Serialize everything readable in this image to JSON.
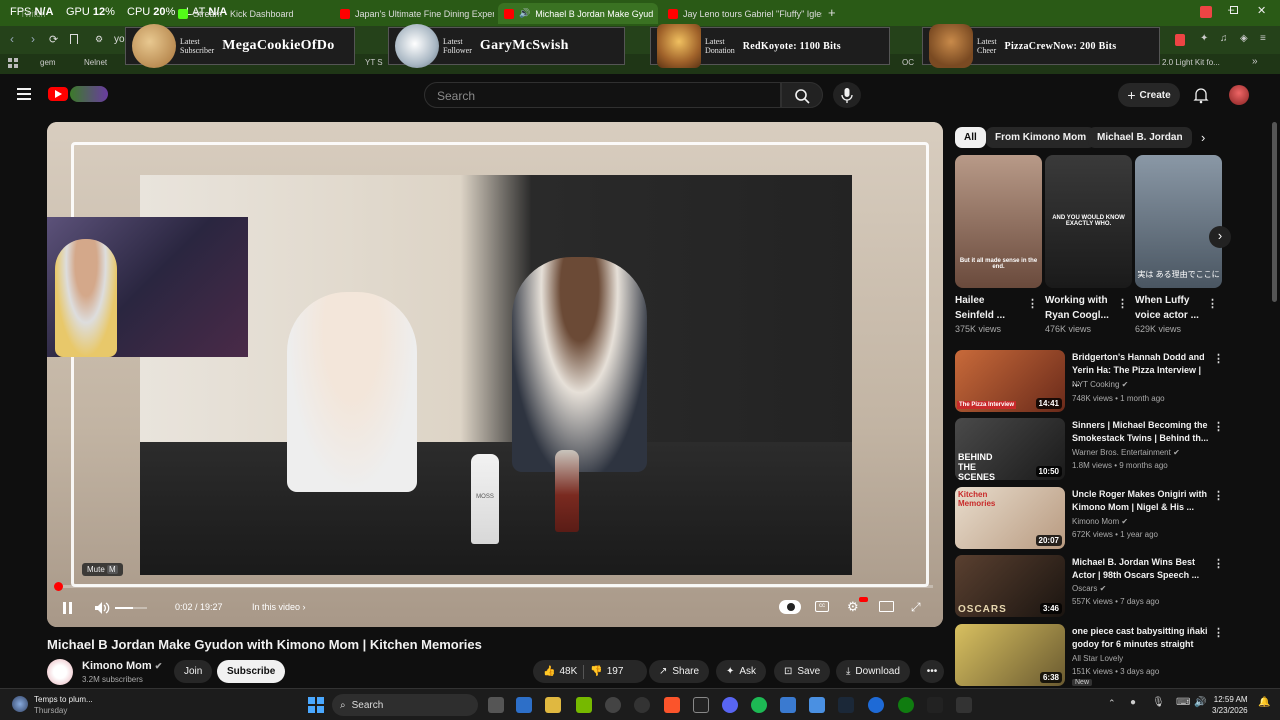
{
  "overlay": {
    "fps_label": "FPS",
    "fps_value": "N/A",
    "gpu_label": "GPU",
    "gpu_value": "12",
    "cpu_label": "CPU",
    "cpu_value": "20",
    "lat_label": "LAT",
    "lat_value": "N/A",
    "percent": "%"
  },
  "tabs": [
    {
      "label": "Twitch"
    },
    {
      "label": "Stream - Kick Dashboard"
    },
    {
      "label": "Japan's Ultimate Fine Dining Experie"
    },
    {
      "label": "Michael B Jordan Make Gyud"
    },
    {
      "label": "Jay Leno tours Gabriel \"Fluffy\" Iglesia"
    }
  ],
  "addressbar": {
    "url": "you"
  },
  "bookmarks": [
    "gem",
    "Nelnet",
    "YT S",
    "OC",
    "2.0 Light Kit fo..."
  ],
  "alerts": [
    {
      "kind1": "Latest",
      "kind2": "Subscriber",
      "name": "MegaCookieOfDo"
    },
    {
      "kind1": "Latest",
      "kind2": "Follower",
      "name": "GaryMcSwish"
    },
    {
      "kind1": "Latest",
      "kind2": "Donation",
      "name": "RedKoyote: 1100 Bits"
    },
    {
      "kind1": "Latest",
      "kind2": "Cheer",
      "name": "PizzaCrewNow: 200 Bits"
    }
  ],
  "header": {
    "search_placeholder": "Search",
    "create_label": "Create"
  },
  "player": {
    "time": "0:02 / 19:27",
    "chapter": "In this video",
    "tooltip": "Mute",
    "tooltip_key": "M",
    "progress": 0.0017,
    "volume": 0.55,
    "bottle_label": "MOSS"
  },
  "video": {
    "title": "Michael B Jordan Make Gyudon with Kimono Mom | Kitchen Memories",
    "channel": "Kimono Mom",
    "subscribers": "3.2M subscribers",
    "join_label": "Join",
    "subscribe_label": "Subscribe",
    "likes": "48K",
    "dislikes": "197",
    "share_label": "Share",
    "ask_label": "Ask",
    "save_label": "Save",
    "download_label": "Download"
  },
  "chips": [
    {
      "label": "All"
    },
    {
      "label": "From Kimono Mom"
    },
    {
      "label": "Michael B. Jordan"
    }
  ],
  "shorts": [
    {
      "title": "Hailee Seinfeld ...",
      "views": "375K views",
      "caption": "But it all made sense in the end."
    },
    {
      "title": "Working with Ryan Coogl...",
      "views": "476K views",
      "caption": "AND YOU WOULD KNOW EXACTLY WHO."
    },
    {
      "title": "When Luffy voice actor ...",
      "views": "629K views",
      "caption": "実は ある理由でここに"
    }
  ],
  "recommended": [
    {
      "title": "Bridgerton's Hannah Dodd and Yerin Ha: The Pizza Interview | ...",
      "channel": "NYT Cooking",
      "meta": "748K views • 1 month ago",
      "duration": "14:41",
      "thumb_text": "The Pizza Interview",
      "verified": true
    },
    {
      "title": "Sinners | Michael Becoming the Smokestack Twins | Behind th...",
      "channel": "Warner Bros. Entertainment",
      "meta": "1.8M views • 9 months ago",
      "duration": "10:50",
      "thumb_text": "BEHIND THE SCENES",
      "verified": true
    },
    {
      "title": "Uncle Roger Makes Onigiri with Kimono Mom | Nigel & His ...",
      "channel": "Kimono Mom",
      "meta": "672K views • 1 year ago",
      "duration": "20:07",
      "thumb_text": "Kitchen Memories",
      "verified": true
    },
    {
      "title": "Michael B. Jordan Wins Best Actor | 98th Oscars Speech ...",
      "channel": "Oscars",
      "meta": "557K views • 7 days ago",
      "duration": "3:46",
      "thumb_text": "OSCARS",
      "verified": true
    },
    {
      "title": "one piece cast babysitting iñaki godoy for 6 minutes straight",
      "channel": "All Star Lovely",
      "meta": "151K views • 3 days ago",
      "duration": "6:38",
      "badge": "New",
      "verified": false
    }
  ],
  "taskbar": {
    "weather_line1": "Temps to plum...",
    "weather_line2": "Thursday",
    "search_label": "Search",
    "time": "12:59 AM",
    "date": "3/23/2026"
  },
  "colors": {
    "accent_red": "#ff0000",
    "title_bar_green": "#2a5a16"
  }
}
